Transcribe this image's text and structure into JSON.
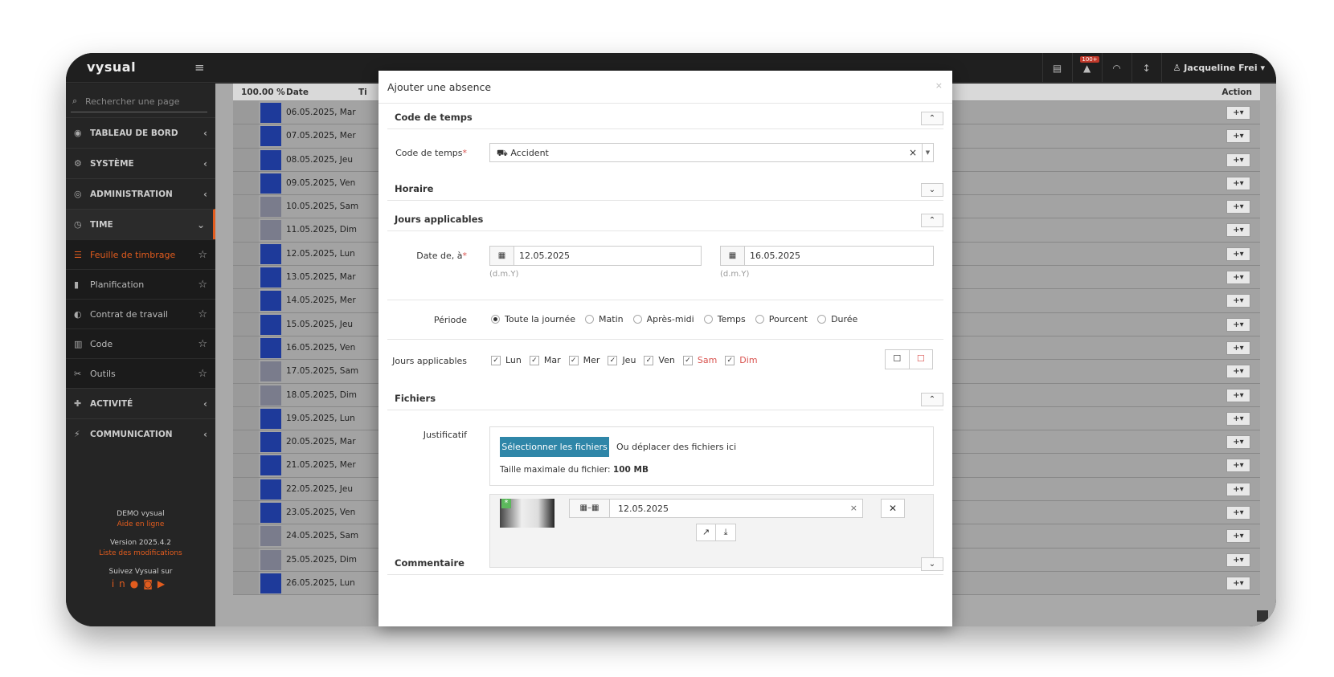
{
  "app": {
    "logo": "vysual",
    "user": "Jacqueline Frei",
    "notif_badge": "100+"
  },
  "sidebar": {
    "search_placeholder": "Rechercher une page",
    "items": [
      {
        "label": "TABLEAU DE BORD"
      },
      {
        "label": "SYSTÈME"
      },
      {
        "label": "ADMINISTRATION"
      },
      {
        "label": "TIME"
      }
    ],
    "sub_items": [
      {
        "label": "Feuille de timbrage"
      },
      {
        "label": "Planification"
      },
      {
        "label": "Contrat de travail"
      },
      {
        "label": "Code"
      },
      {
        "label": "Outils"
      }
    ],
    "items2": [
      {
        "label": "ACTIVITÉ"
      },
      {
        "label": "COMMUNICATION"
      }
    ],
    "footer": {
      "demo": "DEMO vysual",
      "help": "Aide en ligne",
      "version": "Version 2025.4.2",
      "changes": "Liste des modifications",
      "follow": "Suivez Vysual sur"
    }
  },
  "grid": {
    "col_pct": "100.00 %",
    "col_date": "Date",
    "col_ti": "Ti",
    "col_action": "Action",
    "action_label": "+▾",
    "rows": [
      {
        "date": "06.05.2025, Mar",
        "weekend": false
      },
      {
        "date": "07.05.2025, Mer",
        "weekend": false
      },
      {
        "date": "08.05.2025, Jeu",
        "weekend": false
      },
      {
        "date": "09.05.2025, Ven",
        "weekend": false
      },
      {
        "date": "10.05.2025, Sam",
        "weekend": true
      },
      {
        "date": "11.05.2025, Dim",
        "weekend": true
      },
      {
        "date": "12.05.2025, Lun",
        "weekend": false
      },
      {
        "date": "13.05.2025, Mar",
        "weekend": false
      },
      {
        "date": "14.05.2025, Mer",
        "weekend": false
      },
      {
        "date": "15.05.2025, Jeu",
        "weekend": false
      },
      {
        "date": "16.05.2025, Ven",
        "weekend": false
      },
      {
        "date": "17.05.2025, Sam",
        "weekend": true
      },
      {
        "date": "18.05.2025, Dim",
        "weekend": true
      },
      {
        "date": "19.05.2025, Lun",
        "weekend": false
      },
      {
        "date": "20.05.2025, Mar",
        "weekend": false
      },
      {
        "date": "21.05.2025, Mer",
        "weekend": false
      },
      {
        "date": "22.05.2025, Jeu",
        "weekend": false
      },
      {
        "date": "23.05.2025, Ven",
        "weekend": false
      },
      {
        "date": "24.05.2025, Sam",
        "weekend": true
      },
      {
        "date": "25.05.2025, Dim",
        "weekend": true
      },
      {
        "date": "26.05.2025, Lun",
        "weekend": false
      }
    ]
  },
  "modal": {
    "title": "Ajouter une absence",
    "close": "×",
    "sections": {
      "code": "Code de temps",
      "horaire": "Horaire",
      "jours": "Jours applicables",
      "fichiers": "Fichiers",
      "commentaire": "Commentaire"
    },
    "code_label": "Code de temps",
    "code_value": "Accident",
    "date_label": "Date de, à",
    "date_from": "12.05.2025",
    "date_to": "16.05.2025",
    "date_hint": "(d.m.Y)",
    "periode_label": "Période",
    "periode_options": [
      "Toute la journée",
      "Matin",
      "Après-midi",
      "Temps",
      "Pourcent",
      "Durée"
    ],
    "jours_label": "Jours applicables",
    "days": [
      {
        "label": "Lun",
        "weekend": false
      },
      {
        "label": "Mar",
        "weekend": false
      },
      {
        "label": "Mer",
        "weekend": false
      },
      {
        "label": "Jeu",
        "weekend": false
      },
      {
        "label": "Ven",
        "weekend": false
      },
      {
        "label": "Sam",
        "weekend": true
      },
      {
        "label": "Dim",
        "weekend": true
      }
    ],
    "justif_label": "Justificatif",
    "upload_button": "Sélectionner les fichiers",
    "drop_text": "Ou déplacer des fichiers ici",
    "max_size_label": "Taille maximale du fichier:",
    "max_size_value": "100 MB",
    "file_date": "12.05.2025"
  },
  "colors": {
    "accent": "#e25c1e",
    "primary_button": "#2f86a8",
    "bar_weekday": "#1e3a9a",
    "required": "#d9534f"
  }
}
